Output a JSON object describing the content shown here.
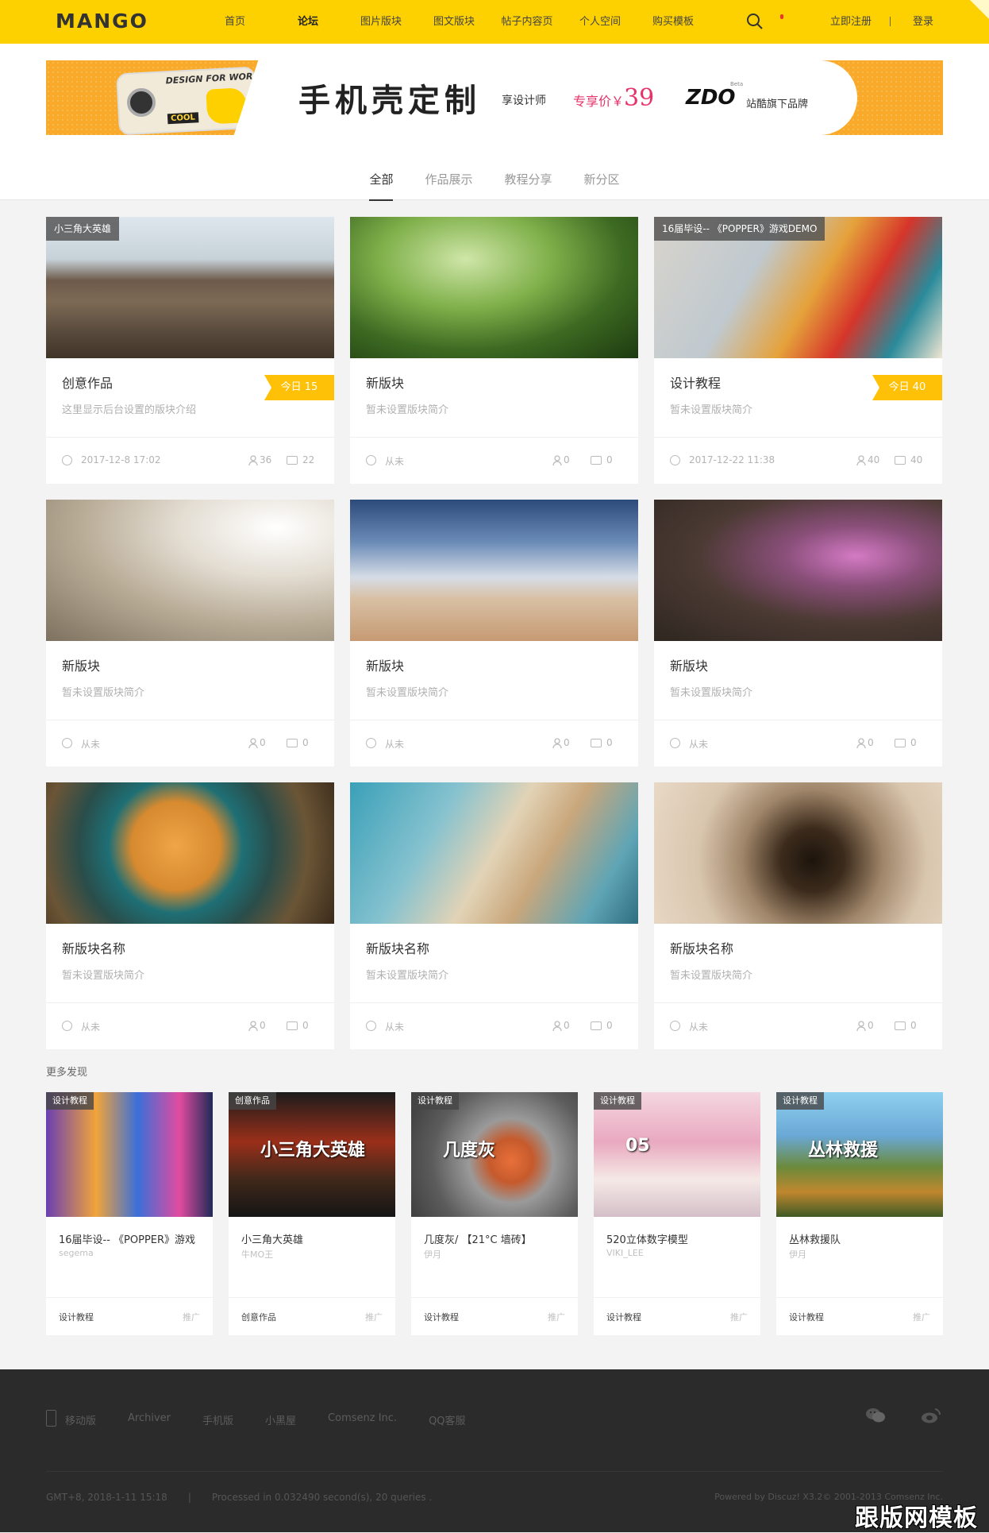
{
  "header": {
    "logo": "MANGO",
    "nav": [
      "首页",
      "论坛",
      "图片版块",
      "图文版块",
      "帖子内容页",
      "个人空间",
      "购买模板"
    ],
    "active_nav": "论坛",
    "register": "立即注册",
    "login": "登录",
    "accent_color": "#fdd000"
  },
  "banner": {
    "title": "手机壳定制",
    "subtitle": "享设计师",
    "price_prefix": "专享价￥",
    "price": "39",
    "brand": "ZDO",
    "brand_tag": "Beta",
    "store": "站酷旗下品牌",
    "phone_text": "DESIGN FOR WOR",
    "phone_badge": "COOL"
  },
  "tabs": [
    "全部",
    "作品展示",
    "教程分享",
    "新分区"
  ],
  "cards": [
    {
      "label": "小三角大英雄",
      "title": "创意作品",
      "desc": "这里显示后台设置的版块介绍",
      "today": "今日 15",
      "time": "2017-12-8 17:02",
      "users": "36",
      "posts": "22"
    },
    {
      "label": "",
      "title": "新版块",
      "desc": "暂未设置版块简介",
      "today": "",
      "time": "从未",
      "users": "0",
      "posts": "0"
    },
    {
      "label": "16届毕设-- 《POPPER》游戏DEMO",
      "title": "设计教程",
      "desc": "暂未设置版块简介",
      "today": "今日 40",
      "time": "2017-12-22 11:38",
      "users": "40",
      "posts": "40"
    },
    {
      "label": "",
      "title": "新版块",
      "desc": "暂未设置版块简介",
      "today": "",
      "time": "从未",
      "users": "0",
      "posts": "0"
    },
    {
      "label": "",
      "title": "新版块",
      "desc": "暂未设置版块简介",
      "today": "",
      "time": "从未",
      "users": "0",
      "posts": "0"
    },
    {
      "label": "",
      "title": "新版块",
      "desc": "暂未设置版块简介",
      "today": "",
      "time": "从未",
      "users": "0",
      "posts": "0"
    },
    {
      "label": "",
      "title": "新版块名称",
      "desc": "暂未设置版块简介",
      "today": "",
      "time": "从未",
      "users": "0",
      "posts": "0"
    },
    {
      "label": "",
      "title": "新版块名称",
      "desc": "暂未设置版块简介",
      "today": "",
      "time": "从未",
      "users": "0",
      "posts": "0"
    },
    {
      "label": "",
      "title": "新版块名称",
      "desc": "暂未设置版块简介",
      "today": "",
      "time": "从未",
      "users": "0",
      "posts": "0"
    }
  ],
  "more": {
    "title": "更多发现",
    "items": [
      {
        "label": "设计教程",
        "title": "16届毕设-- 《POPPER》游戏",
        "author": "segema",
        "cat": "设计教程",
        "promo": "推广"
      },
      {
        "label": "创意作品",
        "title": "小三角大英雄",
        "author": "牛MO王",
        "cat": "创意作品",
        "promo": "推广",
        "img_text": "小三角大英雄"
      },
      {
        "label": "设计教程",
        "title": "几度灰/ 【21°C 墙砖】",
        "author": "伊月",
        "cat": "设计教程",
        "promo": "推广",
        "img_text": "几度灰"
      },
      {
        "label": "设计教程",
        "title": "520立体数字模型",
        "author": "VIKI_LEE",
        "cat": "设计教程",
        "promo": "推广",
        "img_text": "05"
      },
      {
        "label": "设计教程",
        "title": "丛林救援队",
        "author": "伊月",
        "cat": "设计教程",
        "promo": "推广",
        "img_text": "丛林救援"
      }
    ]
  },
  "footer": {
    "links": [
      "移动版",
      "Archiver",
      "手机版",
      "小黑屋",
      "Comsenz Inc.",
      "QQ客服"
    ],
    "time": "GMT+8, 2018-1-11 15:18",
    "processed": "Processed in 0.032490 second(s), 20 queries .",
    "powered": "Powered by Discuz! X3.2© 2001-2013 Comsenz Inc."
  },
  "watermark": "跟版网模板"
}
